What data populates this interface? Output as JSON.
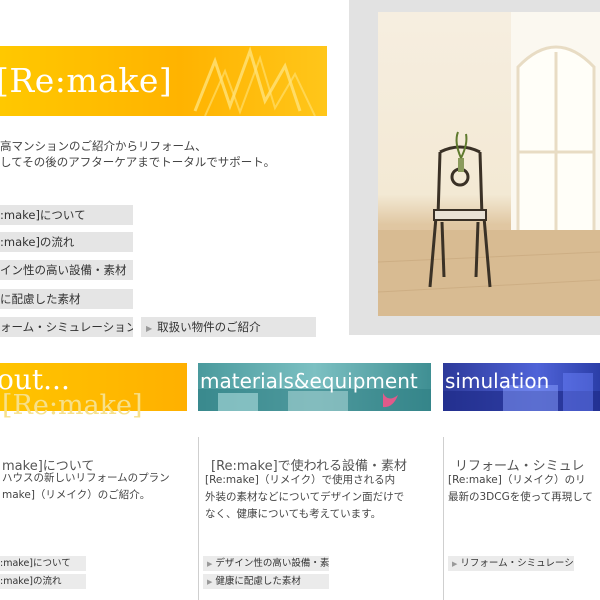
{
  "hero": {
    "logo": "[Re:make]",
    "description_lines": [
      "高マンションのご紹介からリフォーム、",
      "してその後のアフターケアまでトータルでサポート。"
    ]
  },
  "menu": {
    "items": [
      {
        "label": ":make]について"
      },
      {
        "label": ":make]の流れ"
      },
      {
        "label": "イン性の高い設備・素材"
      },
      {
        "label": "に配慮した素材"
      },
      {
        "label": "ォーム・シミュレーション"
      },
      {
        "label": "取扱い物件のご紹介"
      }
    ]
  },
  "photo": {
    "icon": "room-photo-icon"
  },
  "panels": [
    {
      "header": "out...",
      "logo": "[Re:make]",
      "title": "make]について",
      "desc": [
        "ハウスの新しいリフォームのプラン",
        "make]（リメイク）のご紹介。"
      ],
      "links": [
        ":make]について",
        ":make]の流れ"
      ]
    },
    {
      "header": "materials&equipment",
      "title": "[Re:make]で使われる設備・素材",
      "desc": [
        "[Re:make]（リメイク）で使用される内",
        "外装の素材などについてデザイン面だけで",
        "なく、健康についても考えています。"
      ],
      "links": [
        "デザイン性の高い設備・素材",
        "健康に配慮した素材"
      ]
    },
    {
      "header": "simulation",
      "title": "リフォーム・シミュレ",
      "desc": [
        "[Re:make]（リメイク）のリ",
        "最新の3DCGを使って再現して"
      ],
      "links": [
        "リフォーム・シミュレーション"
      ]
    }
  ],
  "colors": {
    "accent_orange": "#ffb300",
    "teal": "#4a9a9d",
    "blue": "#3447b8",
    "menu_bg": "#e5e5e5"
  }
}
